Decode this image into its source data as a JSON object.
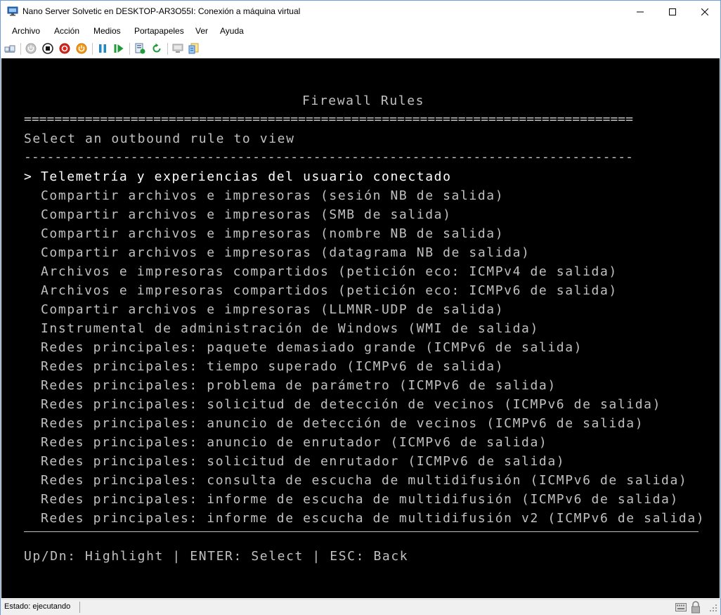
{
  "window": {
    "title": "Nano Server Solvetic en DESKTOP-AR3O55I: Conexión a máquina virtual",
    "minimize_glyph": "—",
    "maximize_glyph": "☐",
    "close_glyph": "✕"
  },
  "menu": {
    "items": [
      "Archivo",
      "Acción",
      "Medios",
      "Portapapeles",
      "Ver",
      "Ayuda"
    ]
  },
  "toolbar": {
    "icons": [
      "ctrl-alt-del-icon",
      "start-icon",
      "turn-off-icon",
      "shut-down-icon",
      "power-icon",
      "pause-icon",
      "resume-icon",
      "checkpoint-icon",
      "revert-icon",
      "enhanced-session-icon",
      "share-icon"
    ]
  },
  "console": {
    "title": "Firewall Rules",
    "separator_double": "================================================================================",
    "prompt": "Select an outbound rule to view",
    "separator_dashed": "--------------------------------------------------------------------------------",
    "cursor": ">",
    "selected_index": 0,
    "rules": [
      "Telemetría y experiencias del usuario conectado",
      "Compartir archivos e impresoras (sesión NB de salida)",
      "Compartir archivos e impresoras (SMB de salida)",
      "Compartir archivos e impresoras (nombre NB de salida)",
      "Compartir archivos e impresoras (datagrama NB de salida)",
      "Archivos e impresoras compartidos (petición eco: ICMPv4 de salida)",
      "Archivos e impresoras compartidos (petición eco: ICMPv6 de salida)",
      "Compartir archivos e impresoras (LLMNR-UDP de salida)",
      "Instrumental de administración de Windows (WMI de salida)",
      "Redes principales: paquete demasiado grande (ICMPv6 de salida)",
      "Redes principales: tiempo superado (ICMPv6 de salida)",
      "Redes principales: problema de parámetro (ICMPv6 de salida)",
      "Redes principales: solicitud de detección de vecinos (ICMPv6 de salida)",
      "Redes principales: anuncio de detección de vecinos (ICMPv6 de salida)",
      "Redes principales: anuncio de enrutador (ICMPv6 de salida)",
      "Redes principales: solicitud de enrutador (ICMPv6 de salida)",
      "Redes principales: consulta de escucha de multidifusión (ICMPv6 de salida)",
      "Redes principales: informe de escucha de multidifusión (ICMPv6 de salida)",
      "Redes principales: informe de escucha de multidifusión v2 (ICMPv6 de salida)"
    ],
    "footer": "Up/Dn: Highlight | ENTER: Select | ESC: Back"
  },
  "status": {
    "text": "Estado: ejecutando"
  },
  "colors": {
    "console_bg": "#000000",
    "console_text": "#c0c0c0",
    "console_highlight": "#ffffff",
    "window_border": "#6f9ed7"
  }
}
